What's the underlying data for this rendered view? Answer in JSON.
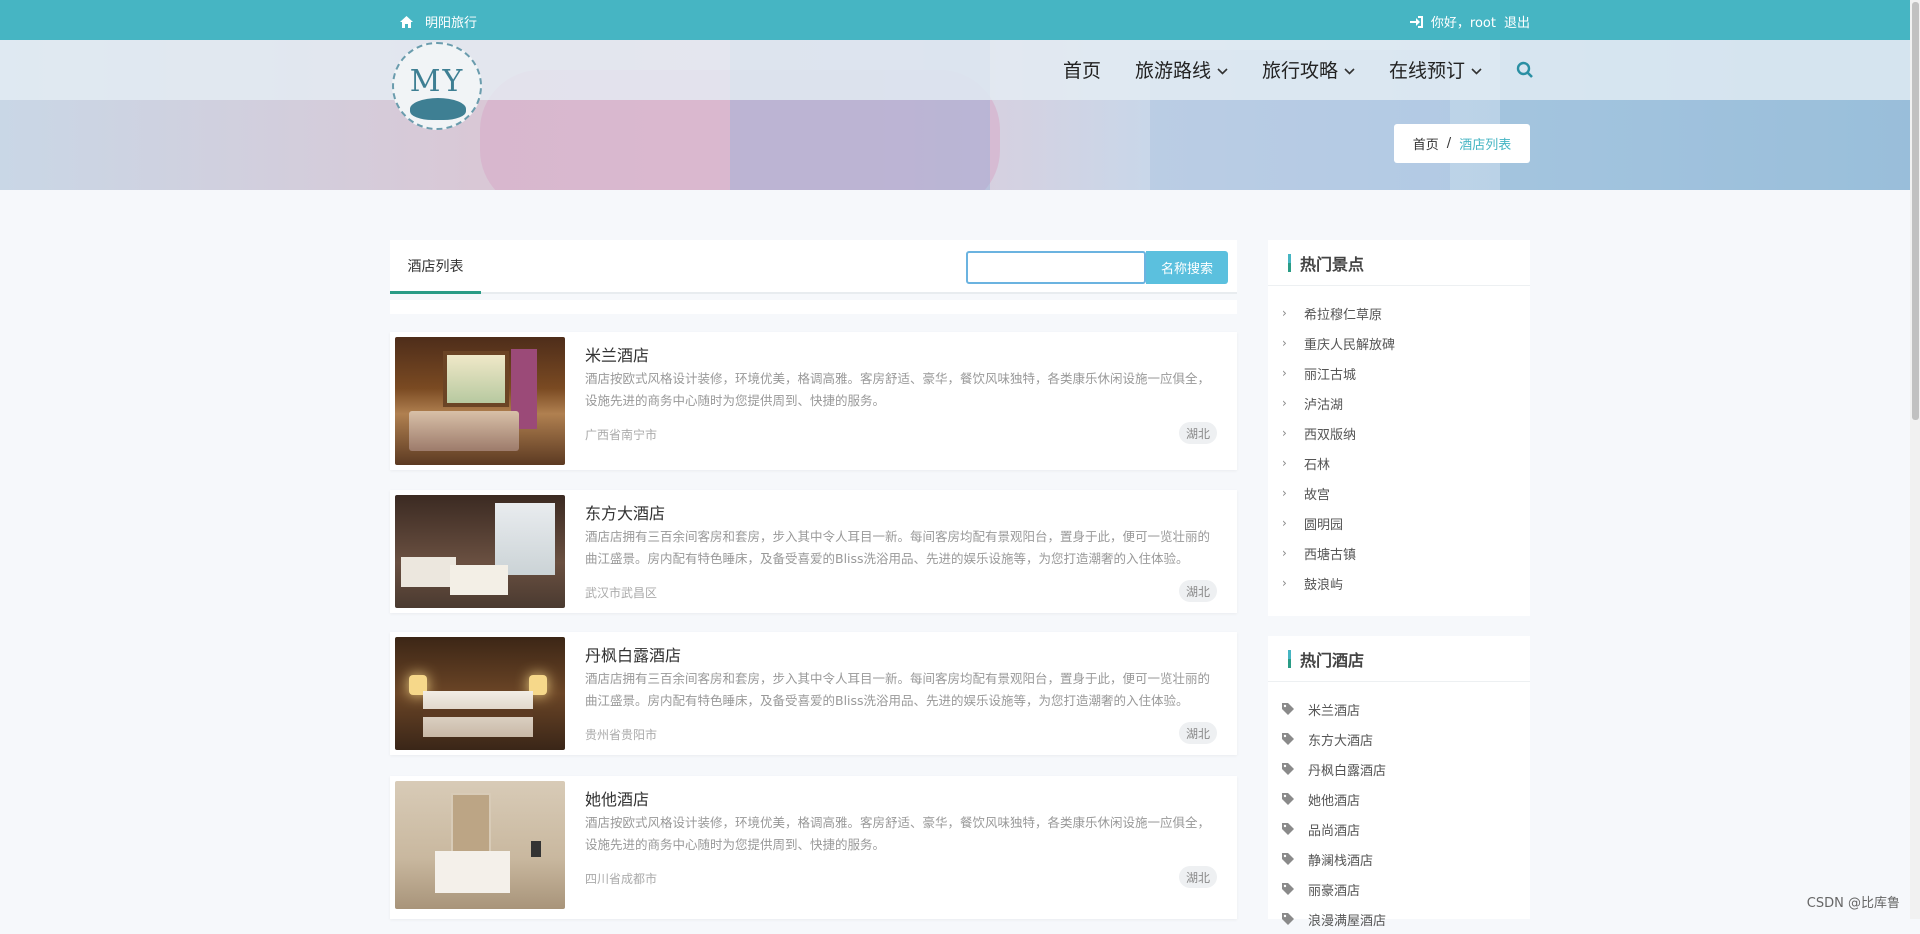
{
  "topbar": {
    "brand": "明阳旅行",
    "greeting": "你好，root",
    "logout": "退出"
  },
  "logo": {
    "text": "MY"
  },
  "nav": {
    "items": [
      {
        "label": "首页"
      },
      {
        "label": "旅游路线"
      },
      {
        "label": "旅行攻略"
      },
      {
        "label": "在线预订"
      }
    ]
  },
  "breadcrumb": {
    "home": "首页",
    "separator": "/",
    "current": "酒店列表"
  },
  "list": {
    "tab": "酒店列表",
    "search_button": "名称搜索",
    "search_value": "",
    "hotels": [
      {
        "name": "米兰酒店",
        "desc": "酒店按欧式风格设计装修，环境优美，格调高雅。客房舒适、豪华，餐饮风味独特，各类康乐休闲设施一应俱全，设施先进的商务中心随时为您提供周到、快捷的服务。",
        "address": "广西省南宁市",
        "tag": "湖北"
      },
      {
        "name": "东方大酒店",
        "desc": "酒店店拥有三百余间客房和套房，步入其中令人耳目一新。每间客房均配有景观阳台，置身于此，便可一览壮丽的曲江盛景。房内配有特色睡床，及备受喜爱的Bliss洗浴用品、先进的娱乐设施等，为您打造潮奢的入住体验。",
        "address": "武汉市武昌区",
        "tag": "湖北"
      },
      {
        "name": "丹枫白露酒店",
        "desc": "酒店店拥有三百余间客房和套房，步入其中令人耳目一新。每间客房均配有景观阳台，置身于此，便可一览壮丽的曲江盛景。房内配有特色睡床，及备受喜爱的Bliss洗浴用品、先进的娱乐设施等，为您打造潮奢的入住体验。",
        "address": "贵州省贵阳市",
        "tag": "湖北"
      },
      {
        "name": "她他酒店",
        "desc": "酒店按欧式风格设计装修，环境优美，格调高雅。客房舒适、豪华，餐饮风味独特，各类康乐休闲设施一应俱全，设施先进的商务中心随时为您提供周到、快捷的服务。",
        "address": "四川省成都市",
        "tag": "湖北"
      }
    ]
  },
  "sidebar": {
    "hot_spots": {
      "title": "热门景点",
      "items": [
        "希拉穆仁草原",
        "重庆人民解放碑",
        "丽江古城",
        "泸沽湖",
        "西双版纳",
        "石林",
        "故宫",
        "圆明园",
        "西塘古镇",
        "鼓浪屿"
      ]
    },
    "hot_hotels": {
      "title": "热门酒店",
      "items": [
        "米兰酒店",
        "东方大酒店",
        "丹枫白露酒店",
        "她他酒店",
        "品尚酒店",
        "静澜栈酒店",
        "丽豪酒店",
        "浪漫满屋酒店"
      ]
    }
  },
  "watermark": "CSDN @比库鲁",
  "colors": {
    "accent": "#46b5c3",
    "tab_underline": "#2a9c86",
    "search_button": "#5bc0de"
  },
  "icons": {
    "home": "home-icon",
    "login": "sign-in-icon",
    "search": "search-icon",
    "chevron": "chevron-down-icon",
    "tag": "tag-icon"
  }
}
